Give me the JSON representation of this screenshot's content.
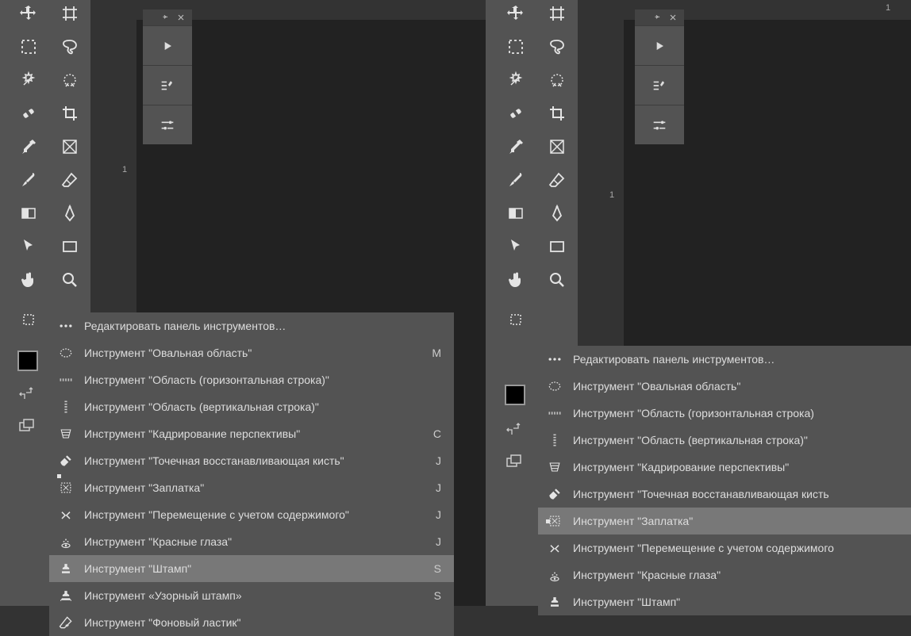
{
  "ruler_label": "1",
  "menu_header": "Редактировать панель инструментов…",
  "items_left": [
    {
      "label": "Инструмент \"Овальная область\"",
      "sc": "M"
    },
    {
      "label": "Инструмент \"Область (горизонтальная строка)\"",
      "sc": ""
    },
    {
      "label": "Инструмент \"Область (вертикальная строка)\"",
      "sc": ""
    },
    {
      "label": "Инструмент \"Кадрирование перспективы\"",
      "sc": "C"
    },
    {
      "label": "Инструмент \"Точечная восстанавливающая кисть\"",
      "sc": "J"
    },
    {
      "label": "Инструмент \"Заплатка\"",
      "sc": "J"
    },
    {
      "label": "Инструмент \"Перемещение с учетом содержимого\"",
      "sc": "J"
    },
    {
      "label": "Инструмент \"Красные глаза\"",
      "sc": "J"
    },
    {
      "label": "Инструмент \"Штамп\"",
      "sc": "S"
    },
    {
      "label": "Инструмент «Узорный штамп»",
      "sc": "S"
    },
    {
      "label": "Инструмент \"Фоновый ластик\"",
      "sc": ""
    }
  ],
  "items_right": [
    {
      "label": "Инструмент \"Овальная область\""
    },
    {
      "label": "Инструмент \"Область (горизонтальная строка)"
    },
    {
      "label": "Инструмент \"Область (вертикальная строка)\""
    },
    {
      "label": "Инструмент \"Кадрирование перспективы\""
    },
    {
      "label": "Инструмент \"Точечная восстанавливающая кисть"
    },
    {
      "label": "Инструмент \"Заплатка\""
    },
    {
      "label": "Инструмент \"Перемещение с учетом содержимого"
    },
    {
      "label": "Инструмент \"Красные глаза\""
    },
    {
      "label": "Инструмент \"Штамп\""
    }
  ],
  "left_selected": 8,
  "right_selected": 5
}
